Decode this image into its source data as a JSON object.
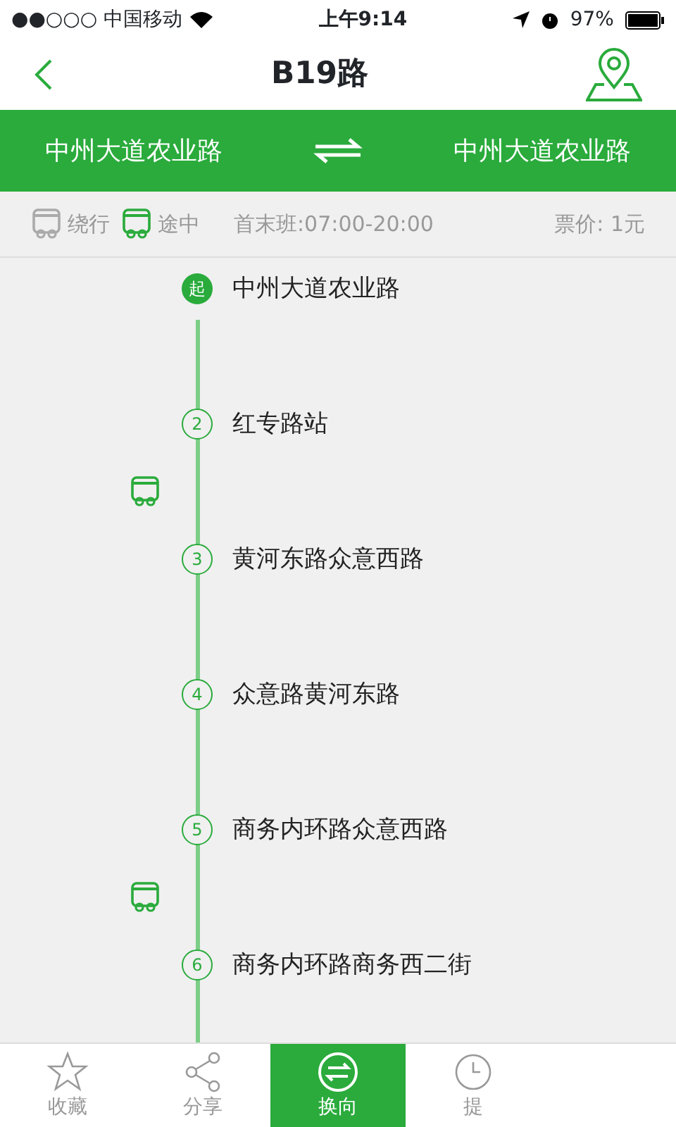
{
  "status_bar": {
    "carrier": "●●○○○ 中国移动",
    "time": "上午9:14",
    "battery": "97%"
  },
  "header": {
    "title": "B19路"
  },
  "direction": {
    "from": "中州大道农业路",
    "to": "中州大道农业路"
  },
  "info": {
    "legend": [
      {
        "label": "绕行",
        "kind": "detour"
      },
      {
        "label": "途中",
        "kind": "enroute"
      }
    ],
    "hours": "首末班:07:00-20:00",
    "fare": "票价: 1元"
  },
  "stations": [
    {
      "badge": "起",
      "name": "中州大道农业路",
      "kind": "start",
      "bus_after": false
    },
    {
      "badge": "2",
      "name": "红专路站",
      "kind": "stop",
      "bus_after": true
    },
    {
      "badge": "3",
      "name": "黄河东路众意西路",
      "kind": "stop",
      "bus_after": false
    },
    {
      "badge": "4",
      "name": "众意路黄河东路",
      "kind": "stop",
      "bus_after": false
    },
    {
      "badge": "5",
      "name": "商务内环路众意西路",
      "kind": "stop",
      "bus_after": true
    },
    {
      "badge": "6",
      "name": "商务内环路商务西二街",
      "kind": "stop",
      "bus_after": false
    }
  ],
  "tabs": [
    {
      "label": "收藏",
      "kind": "star",
      "selected": false
    },
    {
      "label": "分享",
      "kind": "share",
      "selected": false
    },
    {
      "label": "换向",
      "kind": "swap",
      "selected": true
    },
    {
      "label": "提",
      "kind": "clock",
      "selected": false
    }
  ]
}
